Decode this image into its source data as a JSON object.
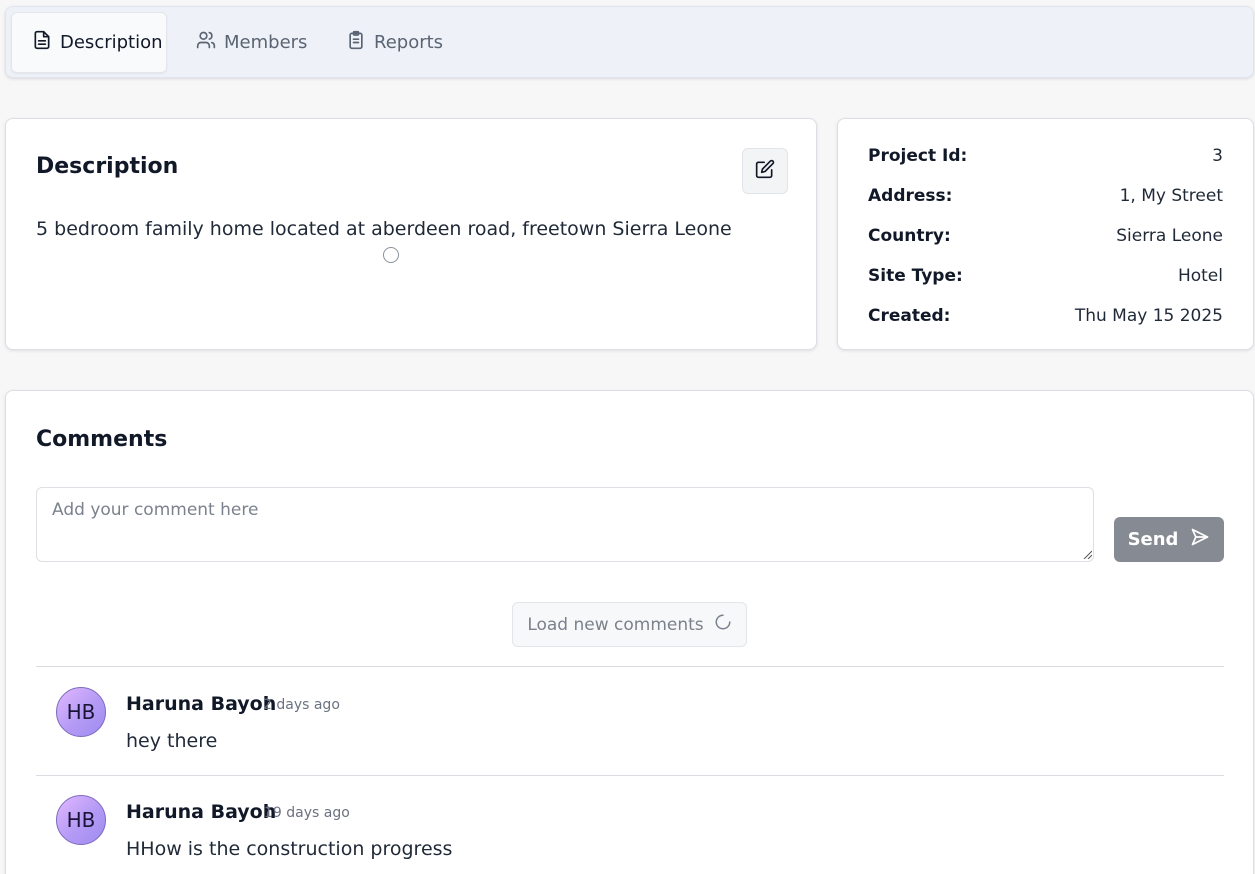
{
  "tabs": [
    {
      "label": "Description",
      "icon": "document-icon",
      "active": true
    },
    {
      "label": "Members",
      "icon": "users-icon",
      "active": false
    },
    {
      "label": "Reports",
      "icon": "clipboard-icon",
      "active": false
    }
  ],
  "description": {
    "title": "Description",
    "text": "5 bedroom family home located at aberdeen road, freetown Sierra Leone"
  },
  "project_info": {
    "rows": [
      {
        "label": "Project Id:",
        "value": "3"
      },
      {
        "label": "Address:",
        "value": "1, My Street"
      },
      {
        "label": "Country:",
        "value": "Sierra Leone"
      },
      {
        "label": "Site Type:",
        "value": "Hotel"
      },
      {
        "label": "Created:",
        "value": "Thu May 15 2025"
      }
    ]
  },
  "comments": {
    "title": "Comments",
    "input_placeholder": "Add your comment here",
    "send_label": "Send",
    "load_label": "Load new comments",
    "items": [
      {
        "initials": "HB",
        "author": "Haruna Bayoh",
        "time": "2 days ago",
        "text": "hey there"
      },
      {
        "initials": "HB",
        "author": "Haruna Bayoh",
        "time": "19 days ago",
        "text": "HHow is the construction progress"
      }
    ]
  },
  "colors": {
    "accent_avatar": "#b49af5",
    "send_button": "#868b93"
  }
}
